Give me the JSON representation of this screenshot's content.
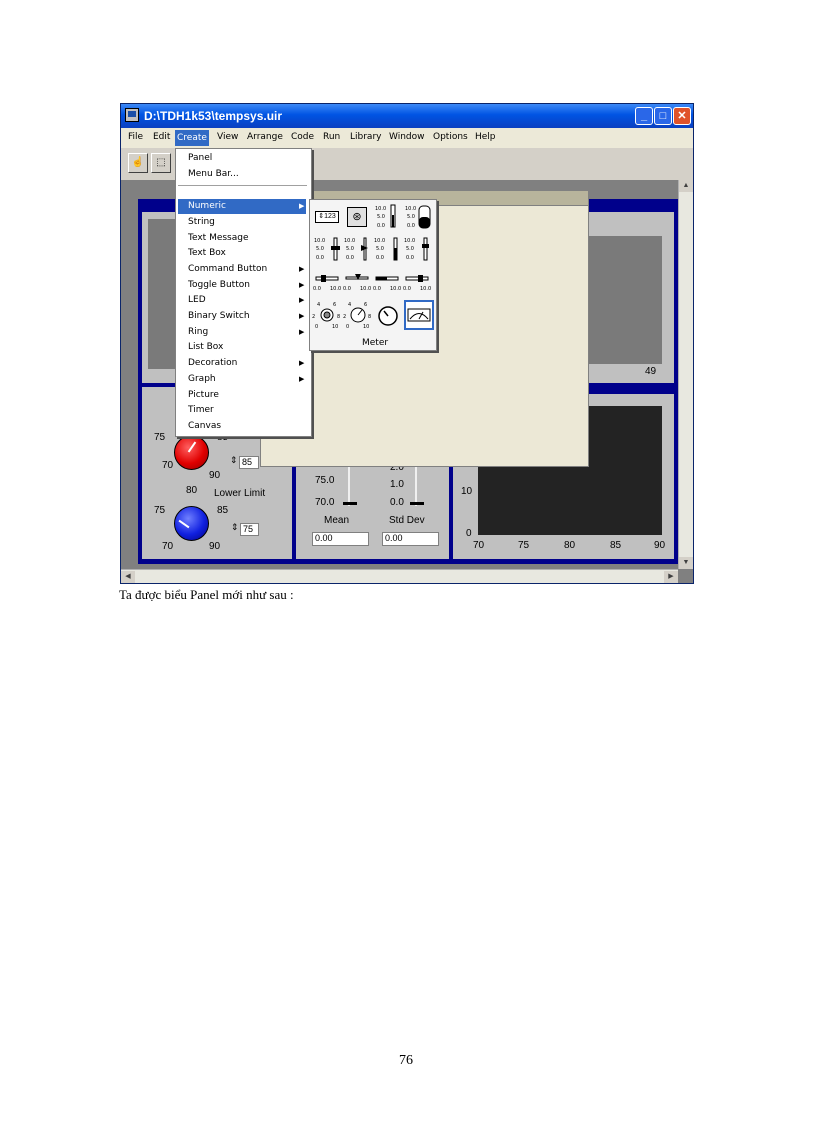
{
  "window": {
    "title": "D:\\TDH1k53\\tempsys.uir"
  },
  "menubar": [
    "File",
    "Edit",
    "Create",
    "View",
    "Arrange",
    "Code",
    "Run",
    "Library",
    "Window",
    "Options",
    "Help"
  ],
  "create_menu": {
    "items": [
      "Panel",
      "Menu Bar...",
      "Numeric",
      "String",
      "Text Message",
      "Text Box",
      "Command Button",
      "Toggle Button",
      "LED",
      "Binary Switch",
      "Ring",
      "List Box",
      "Decoration",
      "Graph",
      "Picture",
      "Timer",
      "Canvas"
    ],
    "highlighted": "Numeric"
  },
  "numeric_submenu": {
    "caption": "Meter",
    "scale_labels": {
      "top": "10.0",
      "mid": "5.0",
      "bottom": "0.0",
      "h_left": "0.0",
      "h_right": "10.0",
      "dial_left": "2",
      "dial_top_left": "4",
      "dial_top_right": "6",
      "dial_right": "8",
      "dial_bl": "0",
      "dial_br": "10"
    }
  },
  "panel": {
    "upper_knob": {
      "tick_left": "75",
      "tick_right": "85",
      "tick_bl": "70",
      "tick_br": "90",
      "value": "85"
    },
    "lower_knob": {
      "label": "Lower Limit",
      "tick_top": "80",
      "tick_left": "75",
      "tick_right": "85",
      "tick_bl": "70",
      "tick_br": "90",
      "value": "75"
    },
    "mean_meter": {
      "label": "Mean",
      "tick_75": "75.0",
      "tick_70": "70.0",
      "value": "0.00"
    },
    "stddev_meter": {
      "label": "Std Dev",
      "tick_2": "2.0",
      "tick_1": "1.0",
      "tick_0": "0.0",
      "value": "0.00"
    },
    "upper_chart_value": "49",
    "histogram": {
      "y_ticks": [
        "10",
        "0"
      ],
      "x_ticks": [
        "70",
        "75",
        "80",
        "85",
        "90"
      ]
    }
  },
  "caption": "Ta được biểu Panel mới như sau :",
  "page_number": "76",
  "colors": {
    "title_bar": "#0054e3",
    "panel_border": "#00008b",
    "menu_highlight": "#316ac5",
    "knob_upper": "#e00000",
    "knob_lower": "#1020e0"
  }
}
